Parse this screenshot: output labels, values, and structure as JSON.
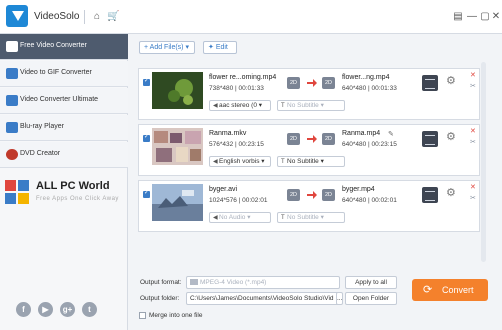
{
  "app": {
    "title": "VideoSolo"
  },
  "titlebar": {
    "home_icon": "home-icon",
    "cart_icon": "cart-icon",
    "menu_icon": "menu-icon",
    "minimize_icon": "minimize-icon",
    "maximize_icon": "maximize-icon",
    "close_icon": "close-icon"
  },
  "sidebar": {
    "items": [
      {
        "label": "Free Video Converter",
        "active": true
      },
      {
        "label": "Video to GIF Converter",
        "active": false
      },
      {
        "label": "Video Converter Ultimate",
        "active": false
      },
      {
        "label": "Blu-ray Player",
        "active": false
      },
      {
        "label": "DVD Creator",
        "active": false
      }
    ],
    "brand": {
      "title": "ALL PC World",
      "subtitle": "Free Apps One Click Away"
    },
    "social": [
      "facebook-icon",
      "youtube-icon",
      "google-plus-icon",
      "twitter-icon"
    ]
  },
  "toolbar": {
    "add_files": "Add File(s)",
    "edit": "Edit"
  },
  "files": [
    {
      "name": "flower re...oming.mp4",
      "meta": "738*480 | 00:01:33",
      "in_badge": "2D",
      "out_badge": "2D",
      "output_name": "flower...ng.mp4",
      "output_meta": "640*480 | 00:01:33",
      "audio": "aac stereo (0",
      "subtitle": "No Subtitle"
    },
    {
      "name": "Ranma.mkv",
      "meta": "576*432 | 00:23:15",
      "in_badge": "2D",
      "out_badge": "2D",
      "output_name": "Ranma.mp4",
      "output_meta": "640*480 | 00:23:15",
      "audio": "English vorbis",
      "subtitle": "No Subtitle"
    },
    {
      "name": "byger.avi",
      "meta": "1024*576 | 00:02:01",
      "in_badge": "2D",
      "out_badge": "2D",
      "output_name": "byger.mp4",
      "output_meta": "640*480 | 00:02:01",
      "audio": "No Audio",
      "subtitle": "No Subtitle"
    }
  ],
  "bottom": {
    "output_format_label": "Output format:",
    "output_format_value": "MPEG-4 Video (*.mp4)",
    "apply_all": "Apply to all",
    "output_folder_label": "Output folder:",
    "output_folder_value": "C:\\Users\\James\\Documents\\VideoSolo Studio\\Vid",
    "browse": "...",
    "open_folder": "Open Folder",
    "merge_label": "Merge into one file",
    "convert": "Convert"
  },
  "colors": {
    "accent": "#3a7cc7",
    "convert": "#f4812c",
    "sidebar_active": "#4e5b6e"
  }
}
